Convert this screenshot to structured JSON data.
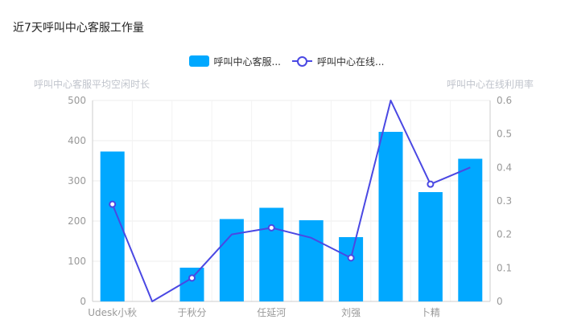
{
  "title": "近7天呼叫中心客服工作量",
  "legend": {
    "bar_label": "呼叫中心客服...",
    "line_label": "呼叫中心在线..."
  },
  "axes": {
    "left_name": "呼叫中心客服平均空闲时长",
    "right_name": "呼叫中心在线利用率"
  },
  "colors": {
    "bar": "#00a8ff",
    "line": "#4a48e3",
    "grid": "#eeeeee",
    "axis": "#cccccc"
  },
  "chart_data": {
    "type": "bar",
    "categories": [
      "Udesk小秋",
      "",
      "于秋分",
      "",
      "任延河",
      "",
      "刘强",
      "",
      "卜精",
      ""
    ],
    "series": [
      {
        "name": "呼叫中心客服...",
        "type": "bar",
        "axis": "left",
        "values": [
          373,
          0,
          84,
          205,
          233,
          202,
          160,
          422,
          272,
          355
        ]
      },
      {
        "name": "呼叫中心在线...",
        "type": "line",
        "axis": "right",
        "values": [
          0.29,
          0,
          0.07,
          0.2,
          0.22,
          0.19,
          0.13,
          0.6,
          0.35,
          0.4
        ],
        "markers": [
          true,
          false,
          true,
          false,
          true,
          false,
          true,
          false,
          true,
          false
        ]
      }
    ],
    "y_left": {
      "min": 0,
      "max": 500,
      "ticks": [
        0,
        100,
        200,
        300,
        400,
        500
      ]
    },
    "y_right": {
      "min": 0,
      "max": 0.6,
      "ticks": [
        0,
        0.1,
        0.2,
        0.3,
        0.4,
        0.5,
        0.6
      ]
    },
    "x_labels_shown": [
      "Udesk小秋",
      "于秋分",
      "任延河",
      "刘强",
      "卜精"
    ],
    "grid": true,
    "legend_position": "top-center"
  }
}
